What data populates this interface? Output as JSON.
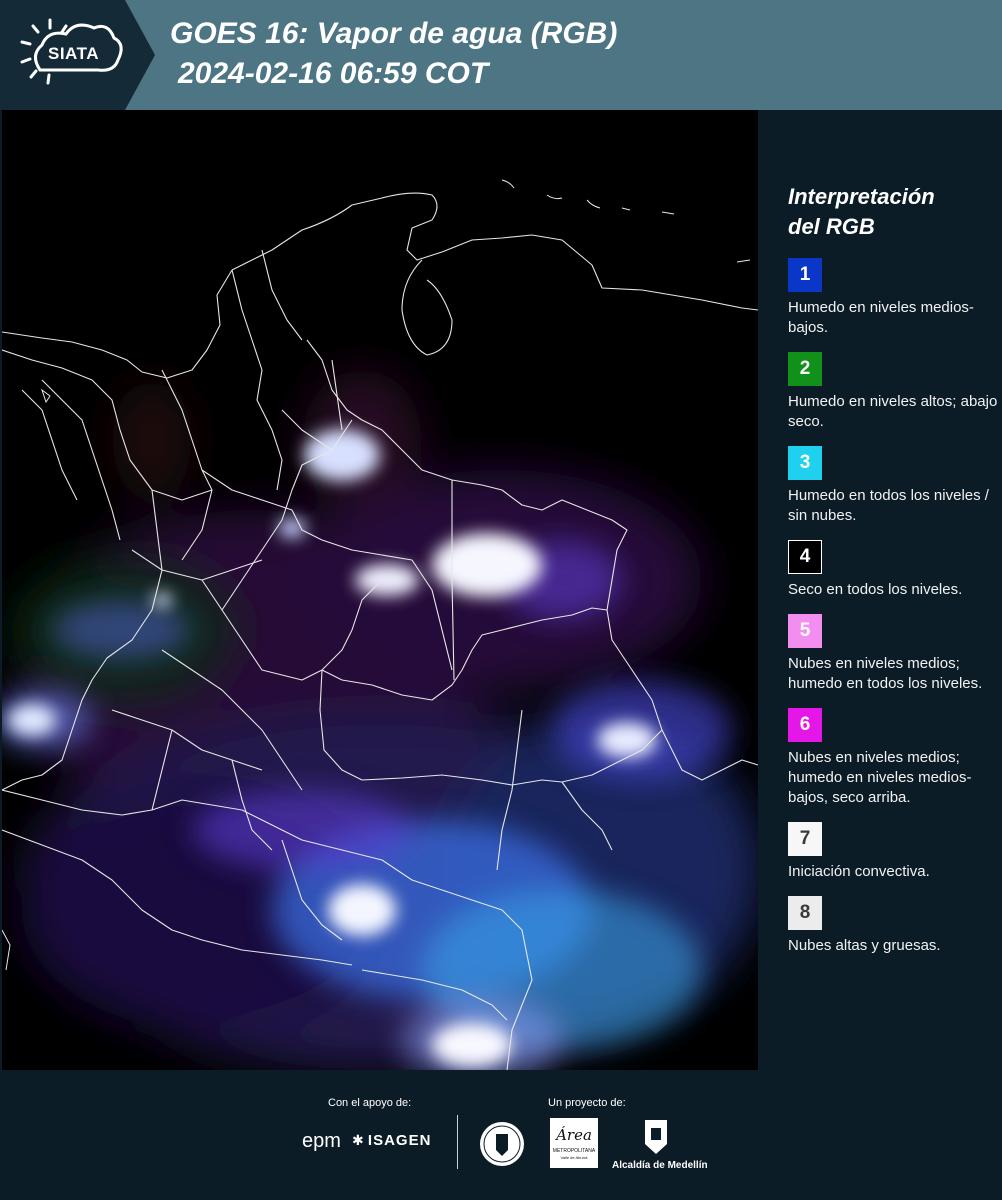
{
  "header": {
    "logo_text": "SIATA",
    "title_line1": "GOES 16: Vapor de agua (RGB)",
    "title_line2": "2024-02-16 06:59 COT"
  },
  "legend": {
    "title_line1": "Interpretación",
    "title_line2": "del RGB",
    "items": [
      {
        "number": "1",
        "color": "#0a37c8",
        "text_color": "#ffffff",
        "border": "none",
        "label": "Humedo en niveles medios-bajos."
      },
      {
        "number": "2",
        "color": "#12911a",
        "text_color": "#ffffff",
        "border": "none",
        "label": "Humedo en niveles altos; abajo seco."
      },
      {
        "number": "3",
        "color": "#1fd1ee",
        "text_color": "#ffffff",
        "border": "none",
        "label": "Humedo en todos los niveles / sin nubes."
      },
      {
        "number": "4",
        "color": "#000000",
        "text_color": "#ffffff",
        "border": "1px solid #ffffff",
        "label": "Seco en todos los niveles."
      },
      {
        "number": "5",
        "color": "#f28ef0",
        "text_color": "#ffffff",
        "border": "none",
        "label": "Nubes en niveles medios; humedo en todos los niveles."
      },
      {
        "number": "6",
        "color": "#e516e8",
        "text_color": "#ffffff",
        "border": "none",
        "label": "Nubes en niveles medios; humedo en niveles medios-bajos, seco arriba."
      },
      {
        "number": "7",
        "color": "#f7f7f7",
        "text_color": "#3a3a3a",
        "border": "none",
        "label": "Iniciación convectiva."
      },
      {
        "number": "8",
        "color": "#ececec",
        "text_color": "#3a3a3a",
        "border": "none",
        "label": "Nubes altas y gruesas."
      }
    ]
  },
  "footer": {
    "support_label": "Con el apoyo de:",
    "project_label": "Un proyecto de:",
    "epm": "epm",
    "isagen": "ISAGEN",
    "area_word": "Área",
    "area_sub": "METROPOLITANA",
    "area_sub2": "Valle de Aburrá",
    "alcaldia": "Alcaldía de Medellín"
  }
}
